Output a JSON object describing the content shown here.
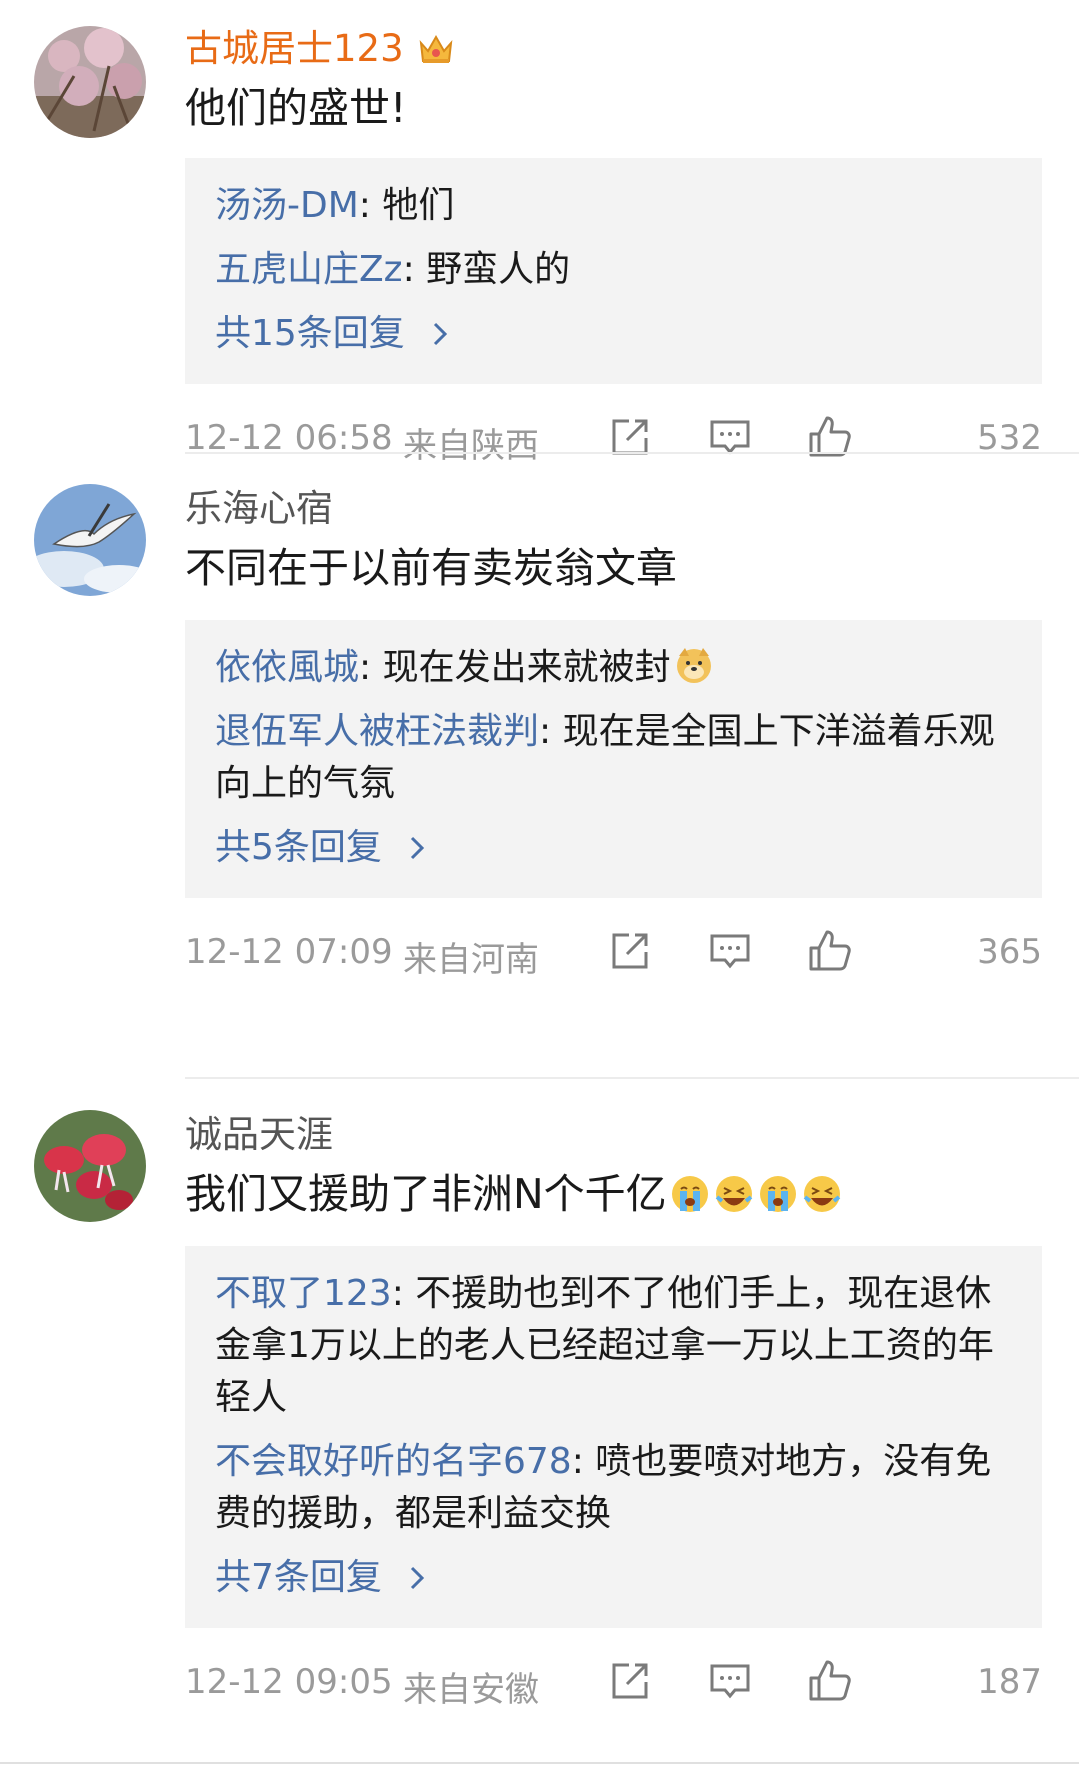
{
  "comments": [
    {
      "username": "古城居士123",
      "content": "他们的盛世!",
      "replies": [
        {
          "user": "汤汤-DM",
          "text": "牠们"
        },
        {
          "user": "五虎山庄Zz",
          "text": "野蛮人的"
        }
      ],
      "more_label": "共15条回复",
      "time": "12-12 06:58",
      "location": "来自陕西",
      "likes": "532"
    },
    {
      "username": "乐海心宿",
      "content": "不同在于以前有卖炭翁文章",
      "replies": [
        {
          "user": "依依風城",
          "text": "现在发出来就被封"
        },
        {
          "user": "退伍军人被枉法裁判",
          "text": "现在是全国上下洋溢着乐观向上的气氛"
        }
      ],
      "more_label": "共5条回复",
      "time": "12-12 07:09",
      "location": "来自河南",
      "likes": "365"
    },
    {
      "username": "诚品天涯",
      "content": "我们又援助了非洲N个千亿",
      "replies": [
        {
          "user": "不取了123",
          "text": "不援助也到不了他们手上，现在退休金拿1万以上的老人已经超过拿一万以上工资的年轻人"
        },
        {
          "user": "不会取好听的名字678",
          "text": "喷也要喷对地方，没有免费的援助，都是利益交换"
        }
      ],
      "more_label": "共7条回复",
      "time": "12-12 09:05",
      "location": "来自安徽",
      "likes": "187"
    }
  ],
  "colors": {
    "vip_name": "#e86b16",
    "link_blue": "#476ea8",
    "meta_gray": "#9a9a9a",
    "reply_bg": "#f3f3f3"
  },
  "icons": [
    "crown-icon",
    "share-icon",
    "comment-icon",
    "like-icon",
    "chevron-right-icon",
    "crying-emoji",
    "laughing-emoji",
    "doge-emoji"
  ]
}
